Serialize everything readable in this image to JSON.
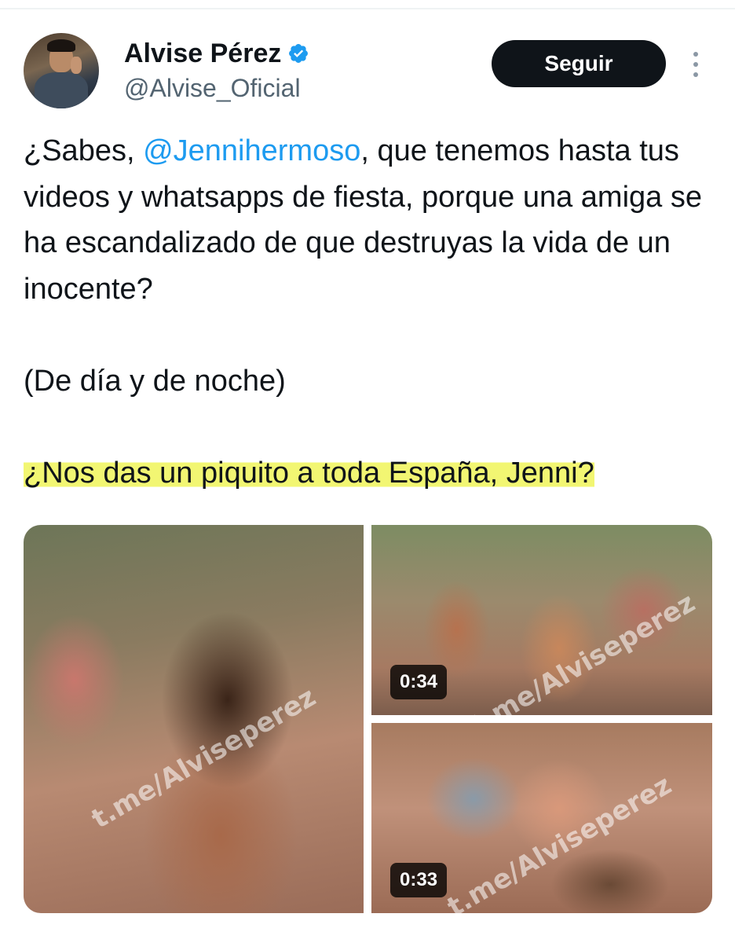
{
  "author": {
    "display_name": "Alvise Pérez",
    "handle": "@Alvise_Oficial",
    "verified_color": "#1d9bf0"
  },
  "actions": {
    "follow_label": "Seguir",
    "more_icon": "more-vertical-icon"
  },
  "tweet": {
    "line1_prefix": "¿Sabes, ",
    "mention": "@Jennihermoso",
    "line1_suffix": ", que tenemos hasta tus videos y whatsapps de fiesta, porque una amiga se ha escandalizado de que destruyas la vida de un inocente?",
    "paragraph2": "(De día y de noche)",
    "paragraph3": "¿Nos das un piquito a toda España, Jenni?"
  },
  "media": {
    "watermark": "t.me/Alviseperez",
    "video_top_duration": "0:34",
    "video_bottom_duration": "0:33"
  },
  "colors": {
    "accent": "#1d9bf0",
    "highlight": "#f0f55a",
    "button_bg": "#0f1419"
  }
}
